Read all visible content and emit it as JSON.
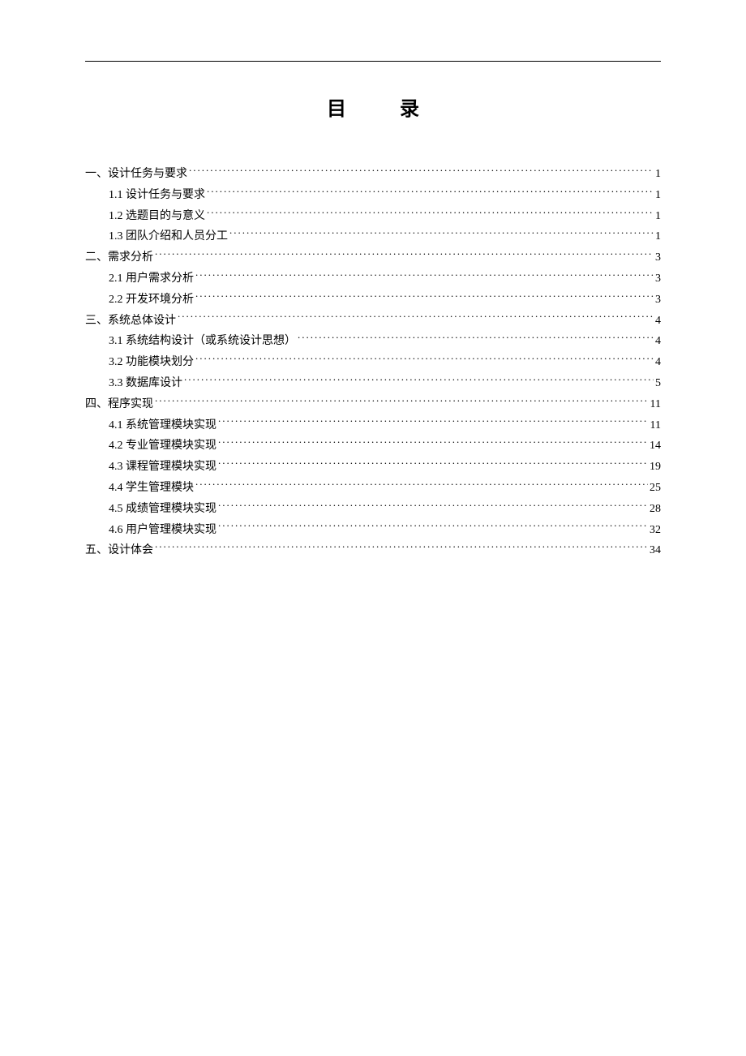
{
  "title": "目 录",
  "toc": [
    {
      "level": 0,
      "label": "一、设计任务与要求",
      "page": "1"
    },
    {
      "level": 1,
      "label": "1.1  设计任务与要求",
      "page": "1"
    },
    {
      "level": 1,
      "label": "1.2  选题目的与意义",
      "page": "1"
    },
    {
      "level": 1,
      "label": "1.3   团队介绍和人员分工",
      "page": "1"
    },
    {
      "level": 0,
      "label": "二、需求分析",
      "page": "3"
    },
    {
      "level": 1,
      "label": "2.1  用户需求分析",
      "page": "3"
    },
    {
      "level": 1,
      "label": "2.2  开发环境分析",
      "page": "3"
    },
    {
      "level": 0,
      "label": "三、系统总体设计",
      "page": "4"
    },
    {
      "level": 1,
      "label": "3.1  系统结构设计（或系统设计思想）",
      "page": "4"
    },
    {
      "level": 1,
      "label": "3.2  功能模块划分",
      "page": "4"
    },
    {
      "level": 1,
      "label": "3.3  数据库设计",
      "page": "5"
    },
    {
      "level": 0,
      "label": "四、程序实现",
      "page": "11"
    },
    {
      "level": 1,
      "label": "4.1  系统管理模块实现",
      "page": "11"
    },
    {
      "level": 1,
      "label": "4.2  专业管理模块实现",
      "page": "14"
    },
    {
      "level": 1,
      "label": "4.3  课程管理模块实现",
      "page": "19"
    },
    {
      "level": 1,
      "label": "4.4  学生管理模块",
      "page": "25"
    },
    {
      "level": 1,
      "label": "4.5  成绩管理模块实现",
      "page": "28"
    },
    {
      "level": 1,
      "label": "4.6 用户管理模块实现",
      "page": "32"
    },
    {
      "level": 0,
      "label": "五、设计体会",
      "page": "34"
    }
  ]
}
